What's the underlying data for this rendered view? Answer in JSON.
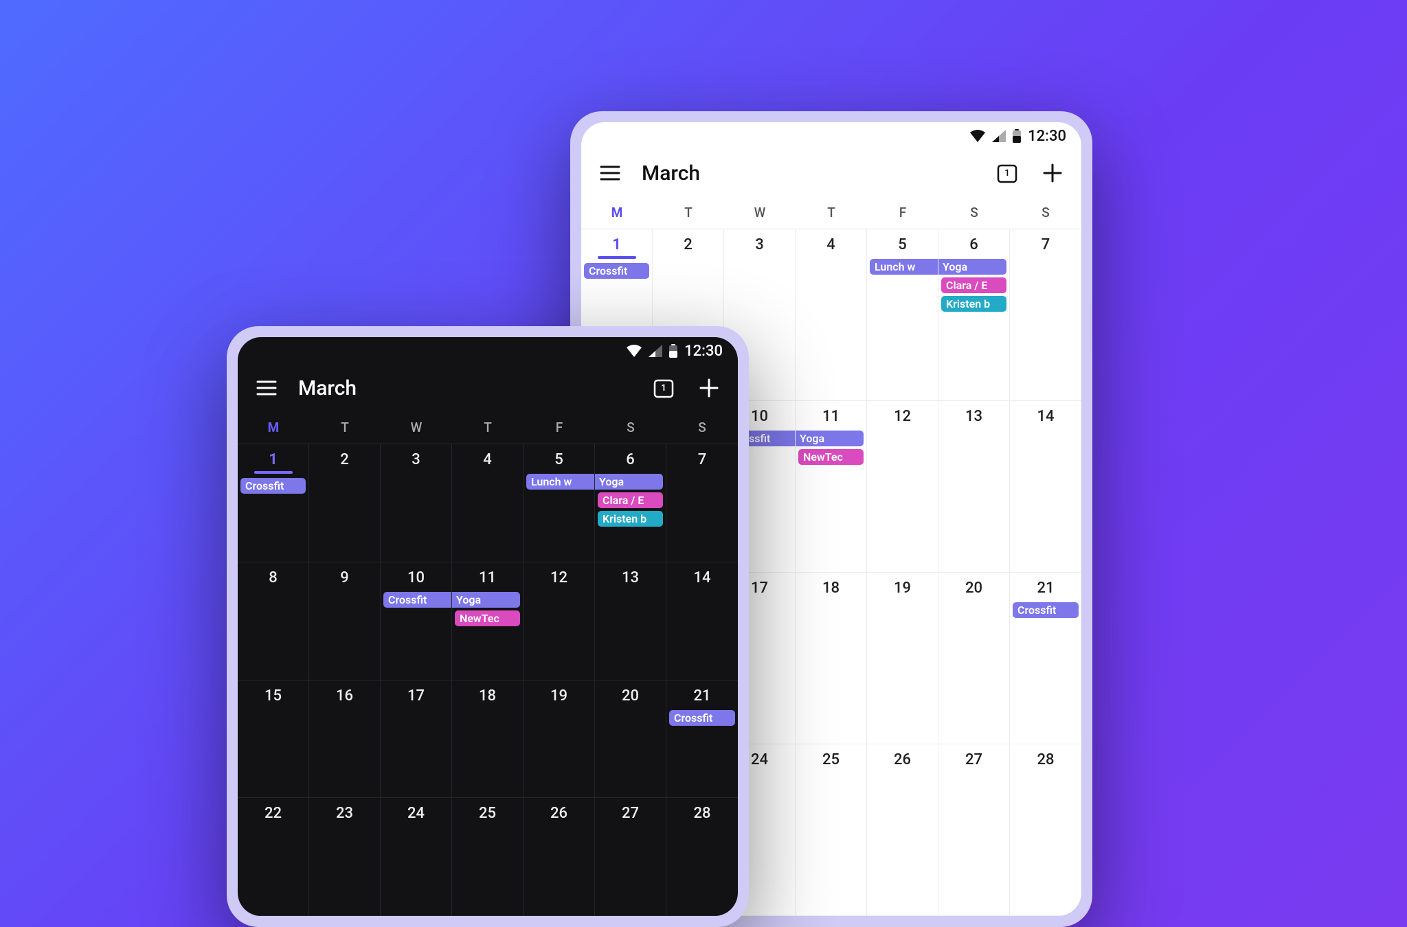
{
  "statusbar": {
    "time": "12:30"
  },
  "header": {
    "title": "March",
    "today_icon_num": "1"
  },
  "weekdays": [
    "M",
    "T",
    "W",
    "T",
    "F",
    "S",
    "S"
  ],
  "weekday_current_index": 0,
  "colors": {
    "lavender": "#7d77ea",
    "magenta": "#d94bbf",
    "teal": "#23aac6"
  },
  "calendar": {
    "today": 1,
    "weeks": [
      [
        {
          "day": 1,
          "events": [
            {
              "label": "Crossfit",
              "color": "lavender"
            }
          ]
        },
        {
          "day": 2
        },
        {
          "day": 3
        },
        {
          "day": 4
        },
        {
          "day": 5,
          "events": [
            {
              "label": "Lunch w",
              "color": "lavender",
              "span": "right"
            }
          ]
        },
        {
          "day": 6,
          "events": [
            {
              "label": "Yoga",
              "color": "lavender",
              "span": "left"
            },
            {
              "label": "Clara / E",
              "color": "magenta"
            },
            {
              "label": "Kristen b",
              "color": "teal"
            }
          ]
        },
        {
          "day": 7
        }
      ],
      [
        {
          "day": 8
        },
        {
          "day": 9
        },
        {
          "day": 10,
          "events": [
            {
              "label": "Crossfit",
              "color": "lavender",
              "span": "right"
            }
          ]
        },
        {
          "day": 11,
          "events": [
            {
              "label": "Yoga",
              "color": "lavender",
              "span": "left"
            },
            {
              "label": "NewTec",
              "color": "magenta"
            }
          ]
        },
        {
          "day": 12
        },
        {
          "day": 13
        },
        {
          "day": 14
        }
      ],
      [
        {
          "day": 15
        },
        {
          "day": 16
        },
        {
          "day": 17
        },
        {
          "day": 18
        },
        {
          "day": 19
        },
        {
          "day": 20
        },
        {
          "day": 21,
          "events": [
            {
              "label": "Crossfit",
              "color": "lavender"
            }
          ]
        }
      ],
      [
        {
          "day": 22
        },
        {
          "day": 23
        },
        {
          "day": 24
        },
        {
          "day": 25
        },
        {
          "day": 26
        },
        {
          "day": 27
        },
        {
          "day": 28
        }
      ]
    ]
  }
}
